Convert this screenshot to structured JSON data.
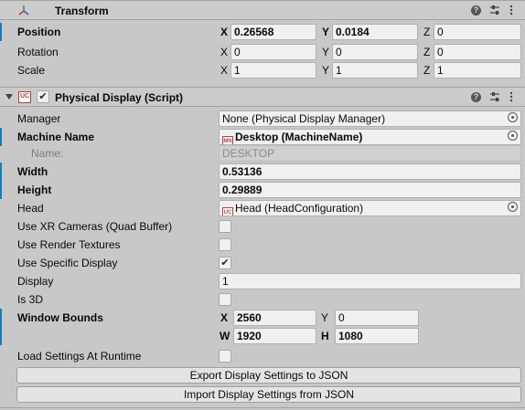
{
  "transform": {
    "title": "Transform",
    "rows": [
      {
        "label": "Position",
        "x": "0.26568",
        "y": "0.0184",
        "z": "0"
      },
      {
        "label": "Rotation",
        "x": "0",
        "y": "0",
        "z": "0"
      },
      {
        "label": "Scale",
        "x": "1",
        "y": "1",
        "z": "1"
      }
    ],
    "axes": {
      "x": "X",
      "y": "Y",
      "z": "Z"
    }
  },
  "physical_display": {
    "title": "Physical Display (Script)",
    "enabled": true,
    "icon_text": "UC",
    "manager": {
      "label": "Manager",
      "value": "None (Physical Display Manager)"
    },
    "machine_name": {
      "label": "Machine Name",
      "value": "Desktop (MachineName)",
      "icon_text": "MN"
    },
    "name": {
      "label": "Name:",
      "value": "DESKTOP"
    },
    "width": {
      "label": "Width",
      "value": "0.53136"
    },
    "height": {
      "label": "Height",
      "value": "0.29889"
    },
    "head": {
      "label": "Head",
      "value": "Head (HeadConfiguration)",
      "icon_text": "UC"
    },
    "use_xr_cameras": {
      "label": "Use XR Cameras (Quad Buffer)",
      "checked": false
    },
    "use_render_textures": {
      "label": "Use Render Textures",
      "checked": false
    },
    "use_specific_display": {
      "label": "Use Specific Display",
      "checked": true
    },
    "display": {
      "label": "Display",
      "value": "1"
    },
    "is_3d": {
      "label": "Is 3D",
      "checked": false
    },
    "window_bounds": {
      "label": "Window Bounds",
      "x_label": "X",
      "x": "2560",
      "y_label": "Y",
      "y": "0",
      "w_label": "W",
      "w": "1920",
      "h_label": "H",
      "h": "1080"
    },
    "load_settings": {
      "label": "Load Settings At Runtime",
      "checked": false
    },
    "export_button": "Export Display Settings to JSON",
    "import_button": "Import Display Settings from JSON"
  },
  "glyphs": {
    "help": "?",
    "check": "✔"
  },
  "colors": {
    "modified_bar": "#0f81be",
    "background": "#c8c8c8"
  }
}
